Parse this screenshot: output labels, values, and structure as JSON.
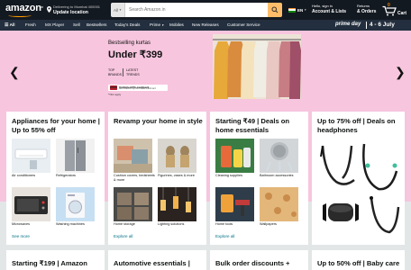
{
  "header": {
    "logo_text": "amazon",
    "logo_suffix": ".in",
    "deliver_line1": "Delivering to Mumbai 400001",
    "deliver_line2": "Update location",
    "search_category": "All",
    "search_placeholder": "Search Amazon.in",
    "language": "EN",
    "account_line1": "Hello, sign in",
    "account_line2": "Account & Lists",
    "returns_line1": "Returns",
    "returns_line2": "& Orders",
    "cart_count": "0",
    "cart_label": "Cart"
  },
  "nav": {
    "all": "All",
    "items": [
      "Fresh",
      "MX Player",
      "Sell",
      "Bestsellers",
      "Today's Deals",
      "Prime",
      "Mobiles",
      "New Releases",
      "Customer Service"
    ],
    "prime_label": "prime day",
    "prime_dates": "4 - 6 July"
  },
  "hero": {
    "subtitle": "Bestselling kurtas",
    "title": "Under ₹399",
    "bullet1_line1": "TOP",
    "bullet1_line2": "BRANDS",
    "bullet2_line1": "LATEST",
    "bullet2_line2": "TRENDS",
    "offer_title": "Unlimited 5% cashback",
    "offer_sub": "with Amazon Pay ICICI Bank credit card",
    "tc": "*T&C apply"
  },
  "cards": [
    {
      "title": "Appliances for your home | Up to 55% off",
      "tiles": [
        "Air conditioners",
        "Refrigerators",
        "Microwaves",
        "Washing machines"
      ],
      "link": "See more"
    },
    {
      "title": "Revamp your home in style",
      "tiles": [
        "Cushion covers, bedsheets & more",
        "Figurines, vases & more",
        "Home storage",
        "Lighting solutions"
      ],
      "link": "Explore all"
    },
    {
      "title": "Starting ₹49 | Deals on home essentials",
      "tiles": [
        "Cleaning supplies",
        "Bathroom accessories",
        "Home tools",
        "Wallpapers"
      ],
      "link": "Explore all"
    },
    {
      "title": "Up to 75% off | Deals on headphones",
      "tiles": [],
      "link": ""
    }
  ],
  "bottom_cards": [
    "Starting ₹199 | Amazon",
    "Automotive essentials |",
    "Bulk order discounts +",
    "Up to 50% off | Baby care"
  ]
}
